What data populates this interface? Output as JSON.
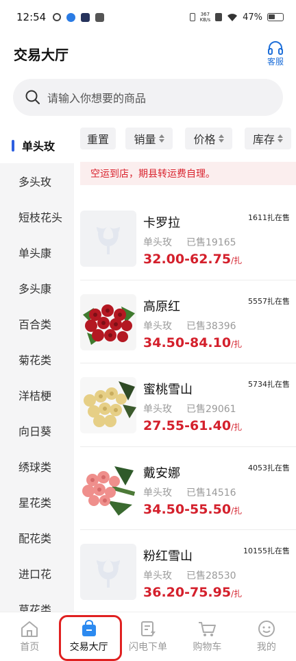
{
  "status": {
    "time": "12:54",
    "net_speed_value": "367",
    "net_speed_unit": "KB/s",
    "battery": "47%"
  },
  "header": {
    "title": "交易大厅",
    "service_label": "客服"
  },
  "search": {
    "placeholder": "请输入你想要的商品"
  },
  "sidebar": {
    "items": [
      {
        "label": "单头玫",
        "active": true
      },
      {
        "label": "多头玫"
      },
      {
        "label": "短枝花头"
      },
      {
        "label": "单头康"
      },
      {
        "label": "多头康"
      },
      {
        "label": "百合类"
      },
      {
        "label": "菊花类"
      },
      {
        "label": "洋桔梗"
      },
      {
        "label": "向日葵"
      },
      {
        "label": "绣球类"
      },
      {
        "label": "星花类"
      },
      {
        "label": "配花类"
      },
      {
        "label": "进口花"
      },
      {
        "label": "草花类"
      }
    ]
  },
  "filters": {
    "reset": "重置",
    "sales": "销量",
    "price": "价格",
    "stock": "库存"
  },
  "notice": "空运到店，期县转运费自理。",
  "products": [
    {
      "name": "卡罗拉",
      "category": "单头玫",
      "sold": "已售19165",
      "price": "32.00-62.75",
      "unit": "/扎",
      "stock": "1611扎在售",
      "image": "placeholder-flower-icon"
    },
    {
      "name": "高原红",
      "category": "单头玫",
      "sold": "已售38396",
      "price": "34.50-84.10",
      "unit": "/扎",
      "stock": "5557扎在售",
      "image": "red-rose-bouquet"
    },
    {
      "name": "蜜桃雪山",
      "category": "单头玫",
      "sold": "已售29061",
      "price": "27.55-61.40",
      "unit": "/扎",
      "stock": "5734扎在售",
      "image": "peach-rose-bouquet"
    },
    {
      "name": "戴安娜",
      "category": "单头玫",
      "sold": "已售14516",
      "price": "34.50-55.50",
      "unit": "/扎",
      "stock": "4053扎在售",
      "image": "pink-rose-bouquet"
    },
    {
      "name": "粉红雪山",
      "category": "单头玫",
      "sold": "已售28530",
      "price": "36.20-75.95",
      "unit": "/扎",
      "stock": "10155扎在售",
      "image": "placeholder-flower-icon"
    }
  ],
  "nav": {
    "items": [
      {
        "label": "首页"
      },
      {
        "label": "交易大厅",
        "active": true
      },
      {
        "label": "闪电下单"
      },
      {
        "label": "购物车"
      },
      {
        "label": "我的"
      }
    ]
  },
  "colors": {
    "accent": "#1e6fd9",
    "price": "#d4202c",
    "highlight_border": "#e02020"
  }
}
